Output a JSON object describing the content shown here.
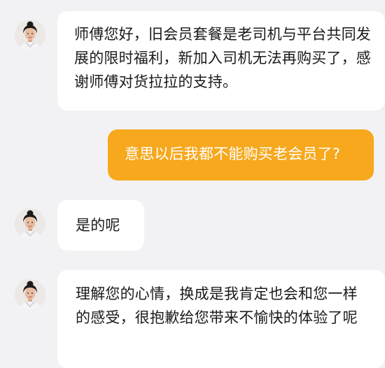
{
  "conversation": {
    "messages": [
      {
        "sender": "agent",
        "text": "师傅您好，旧会员套餐是老司机与平台共同发展的限时福利，新加入司机无法再购买了，感谢师傅对货拉拉的支持。"
      },
      {
        "sender": "user",
        "text": "意思以后我都不能购买老会员了?"
      },
      {
        "sender": "agent",
        "text": "是的呢"
      },
      {
        "sender": "agent",
        "text": "理解您的心情，换成是我肯定也会和您一样的感受，很抱歉给您带来不愉快的体验了呢"
      }
    ]
  },
  "colors": {
    "background": "#f2f2f4",
    "agent_bubble": "#ffffff",
    "user_bubble": "#f7a81d"
  }
}
